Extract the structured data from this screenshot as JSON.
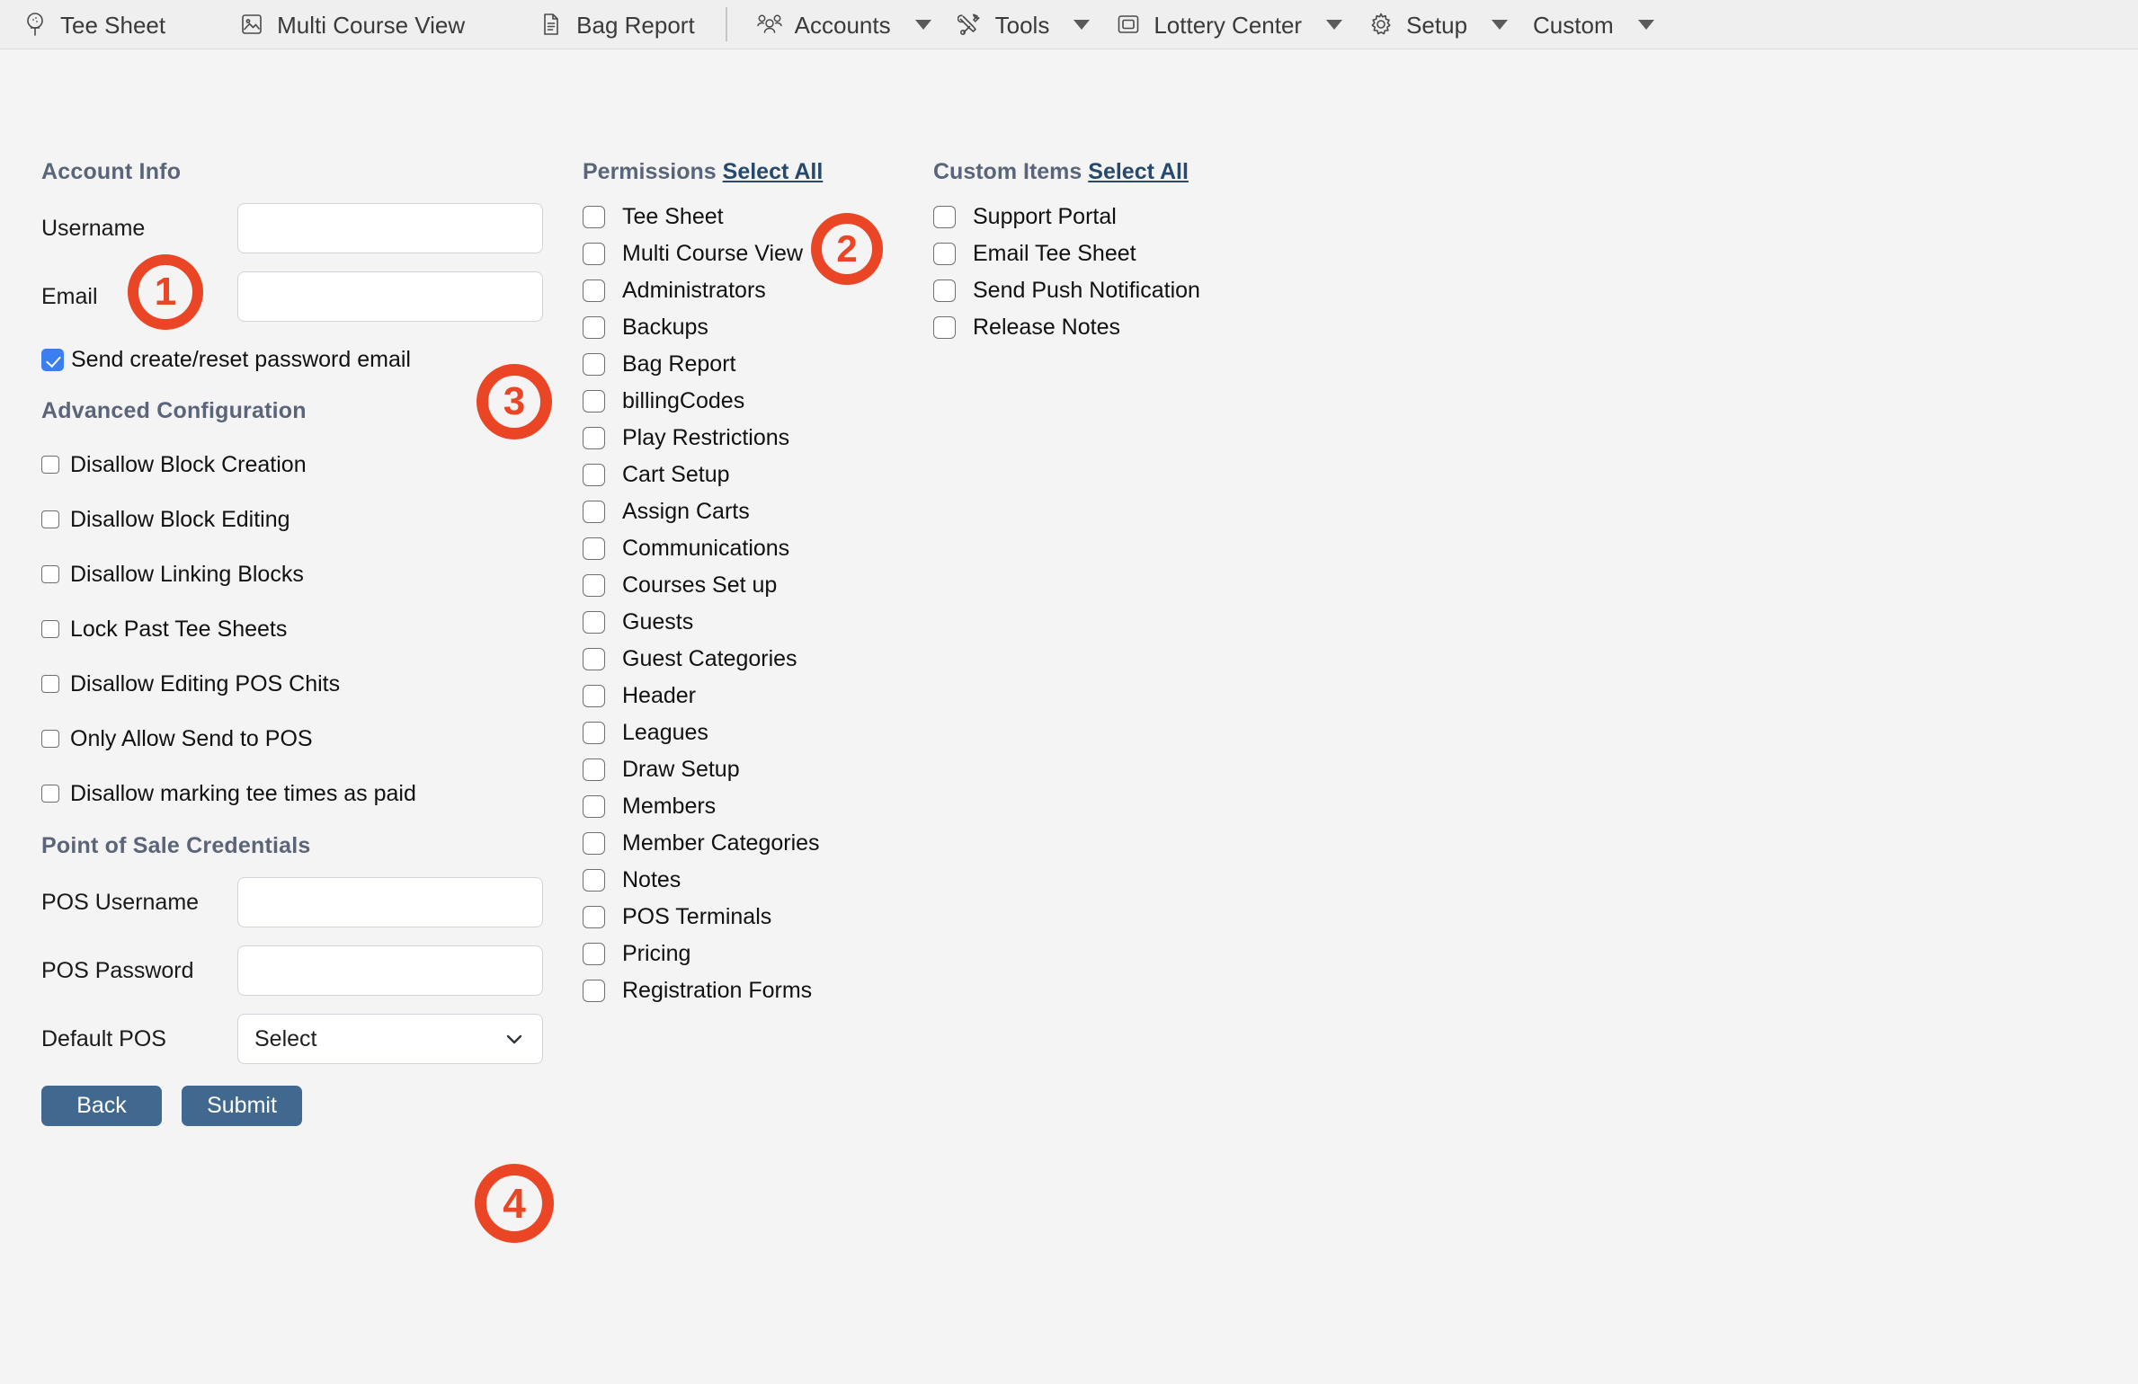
{
  "topnav": {
    "items": [
      {
        "label": "Tee Sheet",
        "icon": "golf-tee-icon",
        "caret": false
      },
      {
        "label": "Multi Course View",
        "icon": "image-icon",
        "caret": false
      },
      {
        "label": "Bag Report",
        "icon": "document-icon",
        "caret": false
      },
      {
        "label": "Accounts",
        "icon": "users-group-icon",
        "caret": true
      },
      {
        "label": "Tools",
        "icon": "tools-icon",
        "caret": true
      },
      {
        "label": "Lottery Center",
        "icon": "ticket-icon",
        "caret": true
      },
      {
        "label": "Setup",
        "icon": "gear-icon",
        "caret": true
      },
      {
        "label": "Custom",
        "icon": "none",
        "caret": true
      }
    ]
  },
  "account_info": {
    "title": "Account Info",
    "username_label": "Username",
    "username_value": "",
    "username_placeholder": "",
    "email_label": "Email",
    "email_value": "",
    "email_placeholder": "",
    "send_password_email_label": "Send create/reset password email",
    "send_password_email_checked": true
  },
  "advanced_configuration": {
    "title": "Advanced Configuration",
    "options": [
      {
        "label": "Disallow Block Creation",
        "checked": false
      },
      {
        "label": "Disallow Block Editing",
        "checked": false
      },
      {
        "label": "Disallow Linking Blocks",
        "checked": false
      },
      {
        "label": "Lock Past Tee Sheets",
        "checked": false
      },
      {
        "label": "Disallow Editing POS Chits",
        "checked": false
      },
      {
        "label": "Only Allow Send to POS",
        "checked": false
      },
      {
        "label": "Disallow marking tee times as paid",
        "checked": false
      }
    ]
  },
  "point_of_sale": {
    "title": "Point of Sale Credentials",
    "pos_username_label": "POS Username",
    "pos_username_value": "",
    "pos_password_label": "POS Password",
    "pos_password_value": "",
    "default_pos_label": "Default POS",
    "default_pos_value": "Select"
  },
  "buttons": {
    "back": "Back",
    "submit": "Submit"
  },
  "permissions": {
    "title": "Permissions",
    "select_all": "Select All",
    "items": [
      {
        "label": "Tee Sheet",
        "checked": false
      },
      {
        "label": "Multi Course View",
        "checked": false
      },
      {
        "label": "Administrators",
        "checked": false
      },
      {
        "label": "Backups",
        "checked": false
      },
      {
        "label": "Bag Report",
        "checked": false
      },
      {
        "label": "billingCodes",
        "checked": false
      },
      {
        "label": "Play Restrictions",
        "checked": false
      },
      {
        "label": "Cart Setup",
        "checked": false
      },
      {
        "label": "Assign Carts",
        "checked": false
      },
      {
        "label": "Communications",
        "checked": false
      },
      {
        "label": "Courses Set up",
        "checked": false
      },
      {
        "label": "Guests",
        "checked": false
      },
      {
        "label": "Guest Categories",
        "checked": false
      },
      {
        "label": "Header",
        "checked": false
      },
      {
        "label": "Leagues",
        "checked": false
      },
      {
        "label": "Draw Setup",
        "checked": false
      },
      {
        "label": "Members",
        "checked": false
      },
      {
        "label": "Member Categories",
        "checked": false
      },
      {
        "label": "Notes",
        "checked": false
      },
      {
        "label": "POS Terminals",
        "checked": false
      },
      {
        "label": "Pricing",
        "checked": false
      },
      {
        "label": "Registration Forms",
        "checked": false
      }
    ]
  },
  "custom_items": {
    "title": "Custom Items",
    "select_all": "Select All",
    "items": [
      {
        "label": "Support Portal",
        "checked": false
      },
      {
        "label": "Email Tee Sheet",
        "checked": false
      },
      {
        "label": "Send Push Notification",
        "checked": false
      },
      {
        "label": "Release Notes",
        "checked": false
      }
    ]
  },
  "annotations": [
    {
      "number": "1"
    },
    {
      "number": "2"
    },
    {
      "number": "3"
    },
    {
      "number": "4"
    }
  ],
  "colors": {
    "badge": "#ea4626",
    "button": "#41698f",
    "heading": "#5b6579",
    "link": "#27496b",
    "checkbox_checked": "#3b7ef0"
  }
}
